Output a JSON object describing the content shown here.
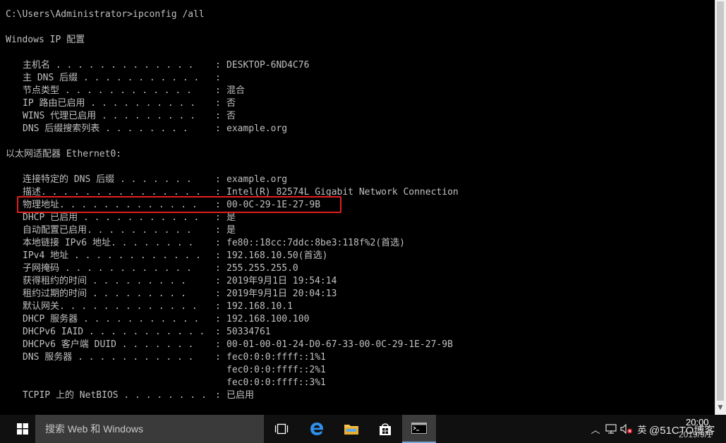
{
  "console": {
    "prompt": "C:\\Users\\Administrator>ipconfig /all",
    "section_windows_ip": "Windows IP 配置",
    "section_adapter": "以太网适配器 Ethernet0:",
    "global_fields": [
      {
        "label": "主机名",
        "dots": " . . . . . . . . . . . . .",
        "value": "DESKTOP-6ND4C76"
      },
      {
        "label": "主 DNS 后缀",
        "dots": " . . . . . . . . . . .",
        "value": ""
      },
      {
        "label": "节点类型",
        "dots": " . . . . . . . . . . . .",
        "value": "混合"
      },
      {
        "label": "IP 路由已启用",
        "dots": " . . . . . . . . . .",
        "value": "否"
      },
      {
        "label": "WINS 代理已启用",
        "dots": " . . . . . . . . .",
        "value": "否"
      },
      {
        "label": "DNS 后缀搜索列表",
        "dots": " . . . . . . . .",
        "value": "example.org"
      }
    ],
    "adapter_fields": [
      {
        "label": "连接特定的 DNS 后缀",
        "dots": " . . . . . . .",
        "value": "example.org"
      },
      {
        "label": "描述",
        "dots": ". . . . . . . . . . . . . . .",
        "value": "Intel(R) 82574L Gigabit Network Connection"
      },
      {
        "label": "物理地址",
        "dots": ". . . . . . . . . . . . .",
        "value": "00-0C-29-1E-27-9B"
      },
      {
        "label": "DHCP 已启用",
        "dots": " . . . . . . . . . . .",
        "value": "是"
      },
      {
        "label": "自动配置已启用",
        "dots": ". . . . . . . . . .",
        "value": "是"
      },
      {
        "label": "本地链接 IPv6 地址",
        "dots": ". . . . . . . .",
        "value": "fe80::18cc:7ddc:8be3:118f%2(首选)"
      },
      {
        "label": "IPv4 地址",
        "dots": " . . . . . . . . . . . .",
        "value": "192.168.10.50(首选)"
      },
      {
        "label": "子网掩码",
        "dots": " . . . . . . . . . . . .",
        "value": "255.255.255.0"
      },
      {
        "label": "获得租约的时间",
        "dots": " . . . . . . . . .",
        "value": "2019年9月1日 19:54:14"
      },
      {
        "label": "租约过期的时间",
        "dots": " . . . . . . . . .",
        "value": "2019年9月1日 20:04:13"
      },
      {
        "label": "默认网关",
        "dots": ". . . . . . . . . . . . .",
        "value": "192.168.10.1"
      },
      {
        "label": "DHCP 服务器",
        "dots": " . . . . . . . . . . .",
        "value": "192.168.100.100"
      },
      {
        "label": "DHCPv6 IAID",
        "dots": " . . . . . . . . . . .",
        "value": "50334761"
      },
      {
        "label": "DHCPv6 客户端 DUID",
        "dots": " . . . . . . .",
        "value": "00-01-00-01-24-D0-67-33-00-0C-29-1E-27-9B"
      },
      {
        "label": "DNS 服务器",
        "dots": " . . . . . . . . . . .",
        "value": "fec0:0:0:ffff::1%1"
      },
      {
        "label": "",
        "dots": "",
        "value": "fec0:0:0:ffff::2%1"
      },
      {
        "label": "",
        "dots": "",
        "value": "fec0:0:0:ffff::3%1"
      },
      {
        "label": "TCPIP 上的 NetBIOS",
        "dots": " . . . . . . . .",
        "value": "已启用"
      }
    ],
    "colon": ":"
  },
  "taskbar": {
    "search_placeholder": "搜索 Web 和 Windows",
    "clock_time": "20:00",
    "clock_date": "2019/9/1",
    "watermark": "@51CTO博客",
    "ime_label": "英"
  },
  "colors": {
    "console_bg": "#000000",
    "console_text": "#c0c0c0",
    "highlight_border": "#e02020",
    "taskbar_bg": "#101010"
  }
}
